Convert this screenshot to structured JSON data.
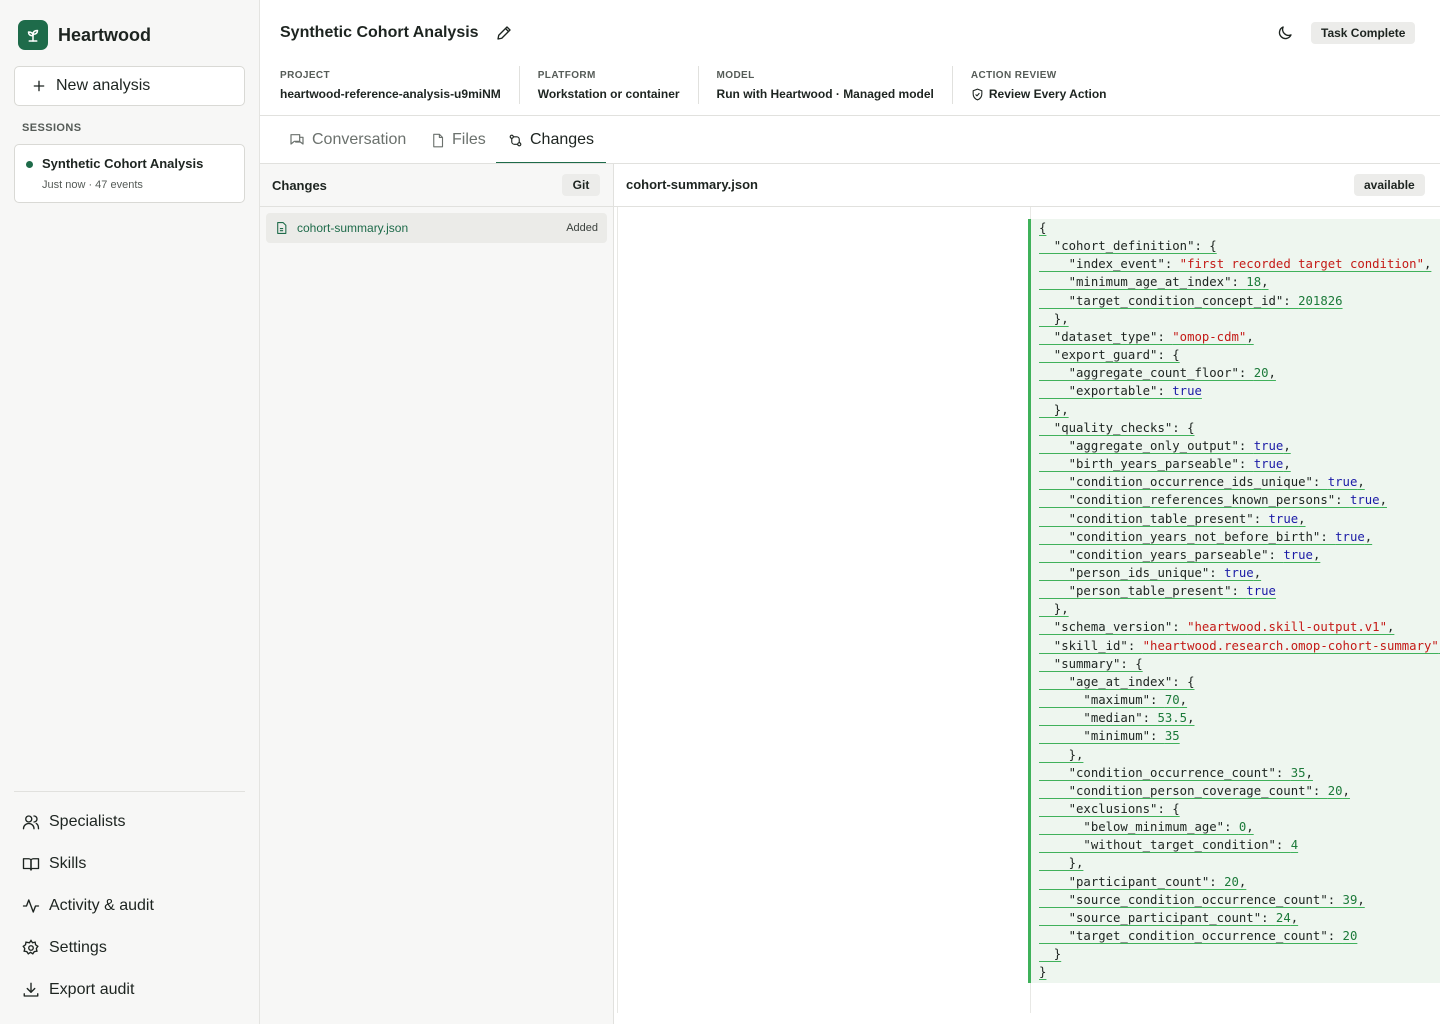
{
  "app": {
    "name": "Heartwood",
    "new_button": "New analysis"
  },
  "sidebar": {
    "sessions_label": "SESSIONS",
    "session": {
      "title": "Synthetic Cohort Analysis",
      "meta": "Just now · 47 events"
    },
    "nav": [
      "Specialists",
      "Skills",
      "Activity & audit",
      "Settings",
      "Export audit"
    ]
  },
  "header": {
    "title": "Synthetic Cohort Analysis",
    "status": "Task Complete",
    "meta": {
      "project_label": "PROJECT",
      "project_value": "heartwood-reference-analysis-u9miNM",
      "platform_label": "PLATFORM",
      "platform_value": "Workstation or container",
      "model_label": "MODEL",
      "model_value": "Run with Heartwood · Managed model",
      "review_label": "ACTION REVIEW",
      "review_value": "Review Every Action"
    }
  },
  "tabs": [
    "Conversation",
    "Files",
    "Changes"
  ],
  "changes": {
    "heading": "Changes",
    "git_label": "Git",
    "files": [
      {
        "name": "cohort-summary.json",
        "status": "Added"
      }
    ]
  },
  "diff": {
    "file_name": "cohort-summary.json",
    "badge": "available",
    "lines": [
      "{",
      "  \"cohort_definition\": {",
      "    \"index_event\": \"first recorded target condition\",",
      "    \"minimum_age_at_index\": 18,",
      "    \"target_condition_concept_id\": 201826",
      "  },",
      "  \"dataset_type\": \"omop-cdm\",",
      "  \"export_guard\": {",
      "    \"aggregate_count_floor\": 20,",
      "    \"exportable\": true",
      "  },",
      "  \"quality_checks\": {",
      "    \"aggregate_only_output\": true,",
      "    \"birth_years_parseable\": true,",
      "    \"condition_occurrence_ids_unique\": true,",
      "    \"condition_references_known_persons\": true,",
      "    \"condition_table_present\": true,",
      "    \"condition_years_not_before_birth\": true,",
      "    \"condition_years_parseable\": true,",
      "    \"person_ids_unique\": true,",
      "    \"person_table_present\": true",
      "  },",
      "  \"schema_version\": \"heartwood.skill-output.v1\",",
      "  \"skill_id\": \"heartwood.research.omop-cohort-summary\",",
      "  \"summary\": {",
      "    \"age_at_index\": {",
      "      \"maximum\": 70,",
      "      \"median\": 53.5,",
      "      \"minimum\": 35",
      "    },",
      "    \"condition_occurrence_count\": 35,",
      "    \"condition_person_coverage_count\": 20,",
      "    \"exclusions\": {",
      "      \"below_minimum_age\": 0,",
      "      \"without_target_condition\": 4",
      "    },",
      "    \"participant_count\": 20,",
      "    \"source_condition_occurrence_count\": 39,",
      "    \"source_participant_count\": 24,",
      "    \"target_condition_occurrence_count\": 20",
      "  }",
      "}"
    ]
  }
}
